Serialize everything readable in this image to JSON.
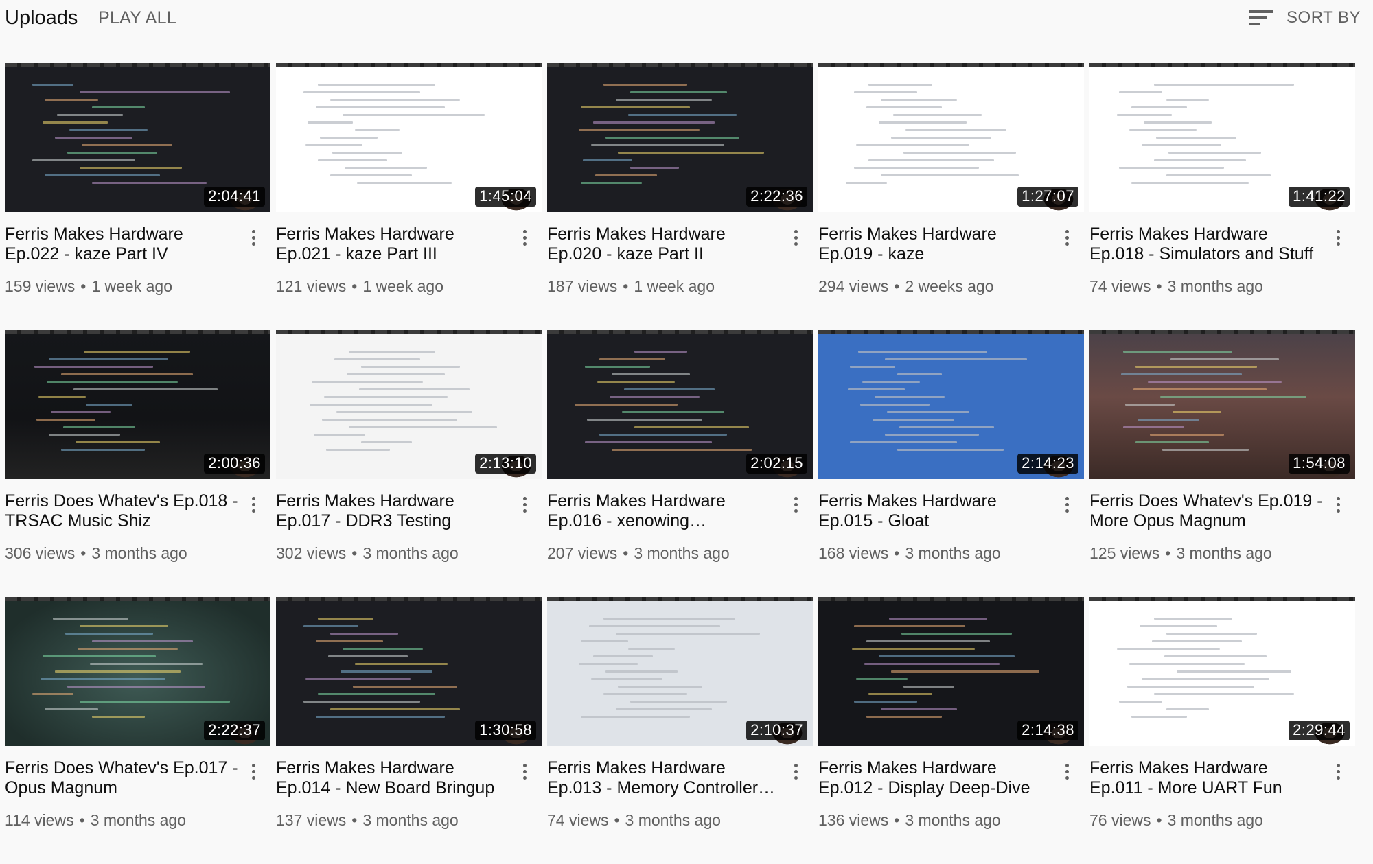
{
  "header": {
    "section_title": "Uploads",
    "play_all_label": "PLAY ALL",
    "sort_label": "SORT BY",
    "sort_icon": "sort-lines-icon"
  },
  "videos": [
    {
      "title": "Ferris Makes Hardware Ep.022 - kaze Part IV",
      "views": "159 views",
      "age": "1 week ago",
      "duration": "2:04:41",
      "theme": "t-dark"
    },
    {
      "title": "Ferris Makes Hardware Ep.021 - kaze Part III",
      "views": "121 views",
      "age": "1 week ago",
      "duration": "1:45:04",
      "theme": "t-light"
    },
    {
      "title": "Ferris Makes Hardware Ep.020 - kaze Part II",
      "views": "187 views",
      "age": "1 week ago",
      "duration": "2:22:36",
      "theme": "t-dark"
    },
    {
      "title": "Ferris Makes Hardware Ep.019 - kaze",
      "views": "294 views",
      "age": "2 weeks ago",
      "duration": "1:27:07",
      "theme": "t-light"
    },
    {
      "title": "Ferris Makes Hardware Ep.018 - Simulators and Stuff",
      "views": "74 views",
      "age": "3 months ago",
      "duration": "1:41:22",
      "theme": "t-light"
    },
    {
      "title": "Ferris Does Whatev's Ep.018 - TRSAC Music Shiz",
      "views": "306 views",
      "age": "3 months ago",
      "duration": "2:00:36",
      "theme": "t-dj"
    },
    {
      "title": "Ferris Makes Hardware Ep.017 - DDR3 Testing",
      "views": "302 views",
      "age": "3 months ago",
      "duration": "2:13:10",
      "theme": "t-sheet"
    },
    {
      "title": "Ferris Makes Hardware Ep.016 - xenowing…",
      "views": "207 views",
      "age": "3 months ago",
      "duration": "2:02:15",
      "theme": "t-dark"
    },
    {
      "title": "Ferris Makes Hardware Ep.015 - Gloat",
      "views": "168 views",
      "age": "3 months ago",
      "duration": "2:14:23",
      "theme": "t-blue"
    },
    {
      "title": "Ferris Does Whatev's Ep.019 - More Opus Magnum",
      "views": "125 views",
      "age": "3 months ago",
      "duration": "1:54:08",
      "theme": "t-city"
    },
    {
      "title": "Ferris Does Whatev's Ep.017 - Opus Magnum",
      "views": "114 views",
      "age": "3 months ago",
      "duration": "2:22:37",
      "theme": "t-teal"
    },
    {
      "title": "Ferris Makes Hardware Ep.014 - New Board Bringup",
      "views": "137 views",
      "age": "3 months ago",
      "duration": "1:30:58",
      "theme": "t-dark"
    },
    {
      "title": "Ferris Makes Hardware Ep.013 - Memory Controller…",
      "views": "74 views",
      "age": "3 months ago",
      "duration": "2:10:37",
      "theme": "t-mixed"
    },
    {
      "title": "Ferris Makes Hardware Ep.012 - Display Deep-Dive",
      "views": "136 views",
      "age": "3 months ago",
      "duration": "2:14:38",
      "theme": "t-noise"
    },
    {
      "title": "Ferris Makes Hardware Ep.011 - More UART Fun",
      "views": "76 views",
      "age": "3 months ago",
      "duration": "2:29:44",
      "theme": "t-light"
    }
  ],
  "icons": {
    "menu": "more-vertical-icon"
  },
  "colors": {
    "background": "#f9f9f9",
    "title_text": "#0f0f0f",
    "secondary_text": "#606060",
    "duration_badge": "#000000"
  }
}
